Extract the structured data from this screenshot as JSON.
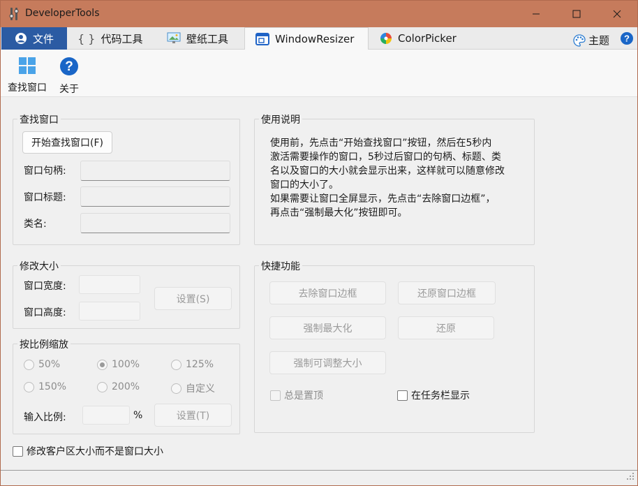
{
  "window": {
    "title": "DeveloperTools",
    "colors": {
      "titlebar": "#c67b5c",
      "file_tab": "#2b5ba3",
      "accent": "#1f63c6"
    }
  },
  "tabs": [
    {
      "label": "文件",
      "icon": "user-circle-icon"
    },
    {
      "label": "代码工具",
      "icon": "braces-icon"
    },
    {
      "label": "壁纸工具",
      "icon": "wallpaper-icon"
    },
    {
      "label": "WindowResizer",
      "icon": "window-resize-icon",
      "active": true
    },
    {
      "label": "ColorPicker",
      "icon": "color-wheel-icon"
    }
  ],
  "theme": {
    "label": "主题",
    "icon": "palette-icon"
  },
  "help_icon": "help-icon",
  "toolbar": {
    "find_window": "查找窗口",
    "about": "关于"
  },
  "find_group": {
    "title": "查找窗口",
    "start_button": "开始查找窗口(F)",
    "handle_label": "窗口句柄:",
    "handle_value": "",
    "title_label": "窗口标题:",
    "title_value": "",
    "class_label": "类名:",
    "class_value": ""
  },
  "usage_group": {
    "title": "使用说明",
    "lines": [
      "使用前，先点击“开始查找窗口”按钮，然后在5秒内",
      "激活需要操作的窗口，5秒过后窗口的句柄、标题、类",
      "名以及窗口的大小就会显示出来，这样就可以随意修改",
      "窗口的大小了。",
      "如果需要让窗口全屏显示，先点击“去除窗口边框”，",
      "再点击“强制最大化”按钮即可。"
    ]
  },
  "resize_group": {
    "title": "修改大小",
    "width_label": "窗口宽度:",
    "height_label": "窗口高度:",
    "set_button": "设置(S)"
  },
  "scale_group": {
    "title": "按比例缩放",
    "options": [
      "50%",
      "100%",
      "125%",
      "150%",
      "200%",
      "自定义"
    ],
    "selected": "100%",
    "input_label": "输入比例:",
    "unit": "%",
    "set_button": "设置(T)"
  },
  "quick_group": {
    "title": "快捷功能",
    "remove_border": "去除窗口边框",
    "restore_border": "还原窗口边框",
    "force_maximize": "强制最大化",
    "restore": "还原",
    "force_resizable": "强制可调整大小",
    "always_on_top": "总是置顶",
    "show_in_taskbar": "在任务栏显示"
  },
  "client_area_checkbox": "修改客户区大小而不是窗口大小"
}
